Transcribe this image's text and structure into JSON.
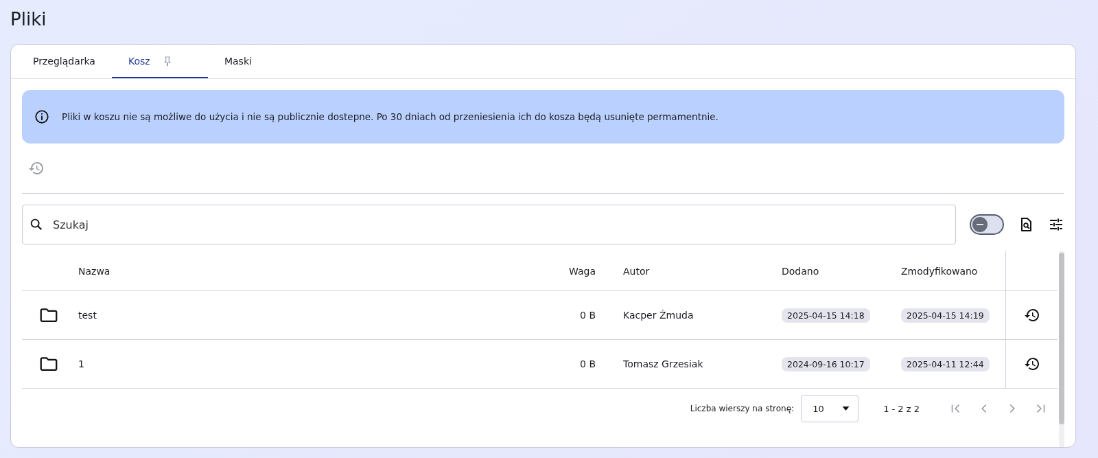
{
  "page_title": "Pliki",
  "tabs": [
    {
      "label": "Przeglądarka",
      "selected": false,
      "pinned": false
    },
    {
      "label": "Kosz",
      "selected": true,
      "pinned": true
    },
    {
      "label": "Maski",
      "selected": false,
      "pinned": false
    }
  ],
  "info_banner": "Pliki w koszu nie są możliwe do użycia i nie są publicznie dostepne. Po 30 dniach od przeniesienia ich do kosza będą usunięte permamentnie.",
  "restore_all_disabled": true,
  "search": {
    "placeholder": "Szukaj"
  },
  "toggle": {
    "on": false
  },
  "table": {
    "columns": [
      "Nazwa",
      "Waga",
      "Autor",
      "Dodano",
      "Zmodyfikowano"
    ],
    "rows": [
      {
        "name": "test",
        "size": "0 B",
        "author": "Kacper Żmuda",
        "added": "2025-04-15 14:18",
        "modified": "2025-04-15 14:19"
      },
      {
        "name": "1",
        "size": "0 B",
        "author": "Tomasz Grzesiak",
        "added": "2024-09-16 10:17",
        "modified": "2025-04-11 12:44"
      }
    ]
  },
  "pagination": {
    "rows_label": "Liczba wierszy na stronę:",
    "rows_value": "10",
    "range": "1 - 2 z 2",
    "buttons": [
      {
        "kind": "first",
        "disabled": true
      },
      {
        "kind": "prev",
        "disabled": true
      },
      {
        "kind": "next",
        "disabled": true
      },
      {
        "kind": "last",
        "disabled": true
      }
    ]
  }
}
